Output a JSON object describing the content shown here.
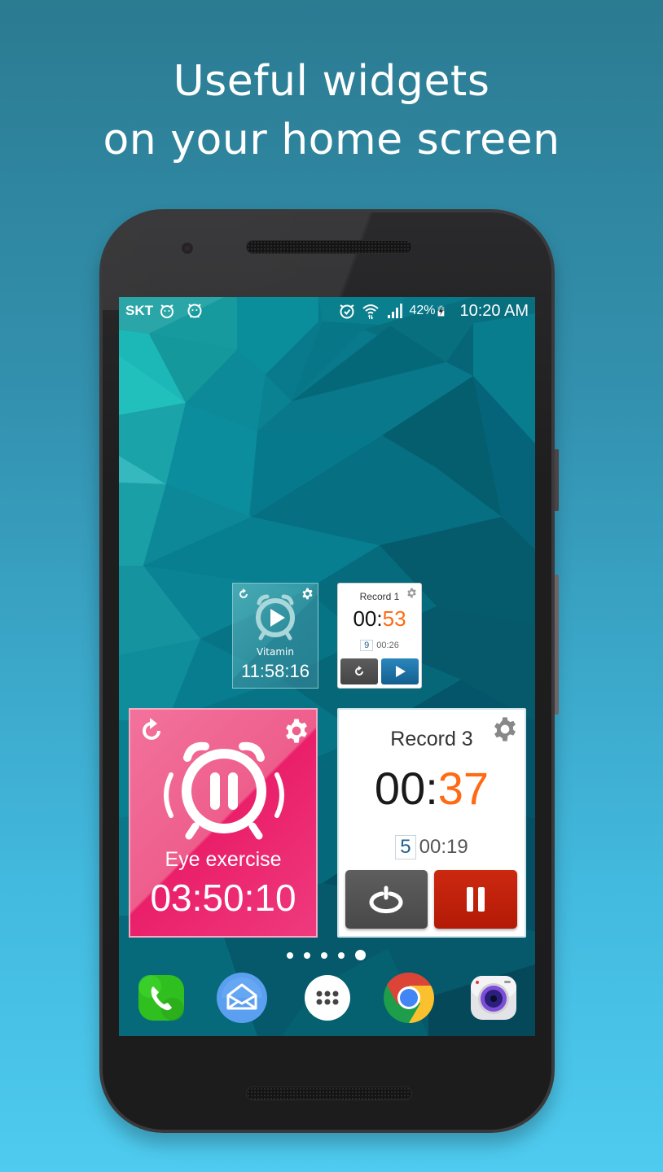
{
  "headline": {
    "line1": "Useful widgets",
    "line2": "on your home screen"
  },
  "status_bar": {
    "carrier": "SKT",
    "left_icons": [
      "alarm-timer-icon",
      "alarm-clock-face-icon"
    ],
    "right_icons": [
      "alarm-clock-icon",
      "wifi-icon",
      "signal-icon",
      "battery-charging-icon"
    ],
    "battery_percent": "42%",
    "battery_level": 0.42,
    "time": "10:20 AM"
  },
  "widgets": {
    "vitamin": {
      "name": "Vitamin",
      "time": "11:58:16",
      "state": "paused",
      "icons": [
        "reset-icon",
        "settings-icon",
        "alarm-play-icon"
      ]
    },
    "record1": {
      "title": "Record 1",
      "time_main": "00:",
      "time_accent": "53",
      "lap_count": "9",
      "lap_time": "00:26",
      "buttons": [
        "reset-button",
        "play-button"
      ]
    },
    "eye_exercise": {
      "name": "Eye exercise",
      "time": "03:50:10",
      "state": "running",
      "icons": [
        "reset-icon",
        "settings-icon",
        "alarm-pause-icon"
      ]
    },
    "record3": {
      "title": "Record 3",
      "time_main": "00:",
      "time_accent": "37",
      "lap_count": "5",
      "lap_time": "00:19",
      "buttons": [
        "lap-reset-button",
        "pause-button"
      ]
    }
  },
  "page_indicator": {
    "total": 5,
    "current": 5
  },
  "dock": [
    {
      "name": "Phone"
    },
    {
      "name": "Email"
    },
    {
      "name": "Apps"
    },
    {
      "name": "Chrome"
    },
    {
      "name": "Camera"
    }
  ],
  "colors": {
    "accent_orange": "#ff6a13",
    "eye_pink": "#ea1f6a",
    "play_blue": "#1a6fa0",
    "pause_red": "#c21d0b",
    "reset_gray": "#555555"
  }
}
